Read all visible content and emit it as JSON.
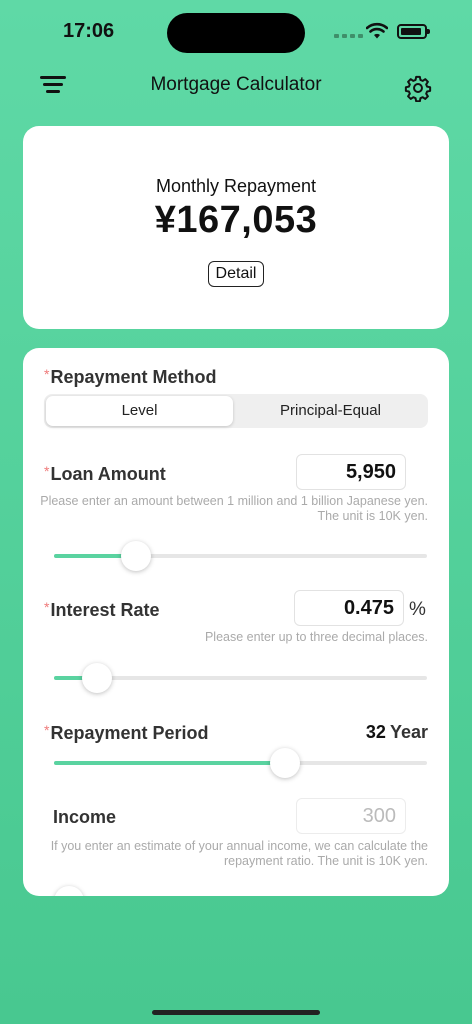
{
  "status_bar": {
    "time": "17:06",
    "icons": [
      "signal-dots-icon",
      "wifi-icon",
      "battery-icon"
    ]
  },
  "nav": {
    "title": "Mortgage Calculator",
    "menu_icon": "menu-icon",
    "settings_icon": "gear-icon"
  },
  "result": {
    "label": "Monthly Repayment",
    "value": "¥167,053",
    "detail_button": "Detail"
  },
  "form": {
    "required_mark": "*",
    "repayment_method": {
      "label": "Repayment Method",
      "options": [
        "Level",
        "Principal-Equal"
      ],
      "selected": "Level"
    },
    "loan_amount": {
      "label": "Loan Amount",
      "value": "5,950",
      "hint": "Please enter an amount between 1 million and 1 billion Japanese yen. The unit is 10K yen.",
      "slider_fraction": 0.22
    },
    "interest_rate": {
      "label": "Interest Rate",
      "value": "0.475",
      "unit": "%",
      "hint": "Please enter up to three decimal places.",
      "slider_fraction": 0.115
    },
    "repayment_period": {
      "label": "Repayment Period",
      "value": "32",
      "unit": "Year",
      "slider_fraction": 0.62
    },
    "income": {
      "label": "Income",
      "placeholder": "300",
      "hint": "If you enter an estimate of your annual income, we can calculate the repayment ratio. The unit is 10K yen."
    }
  },
  "colors": {
    "accent": "#5ad3a0",
    "background": "#5fd9a6",
    "required": "#ef7a7a"
  }
}
